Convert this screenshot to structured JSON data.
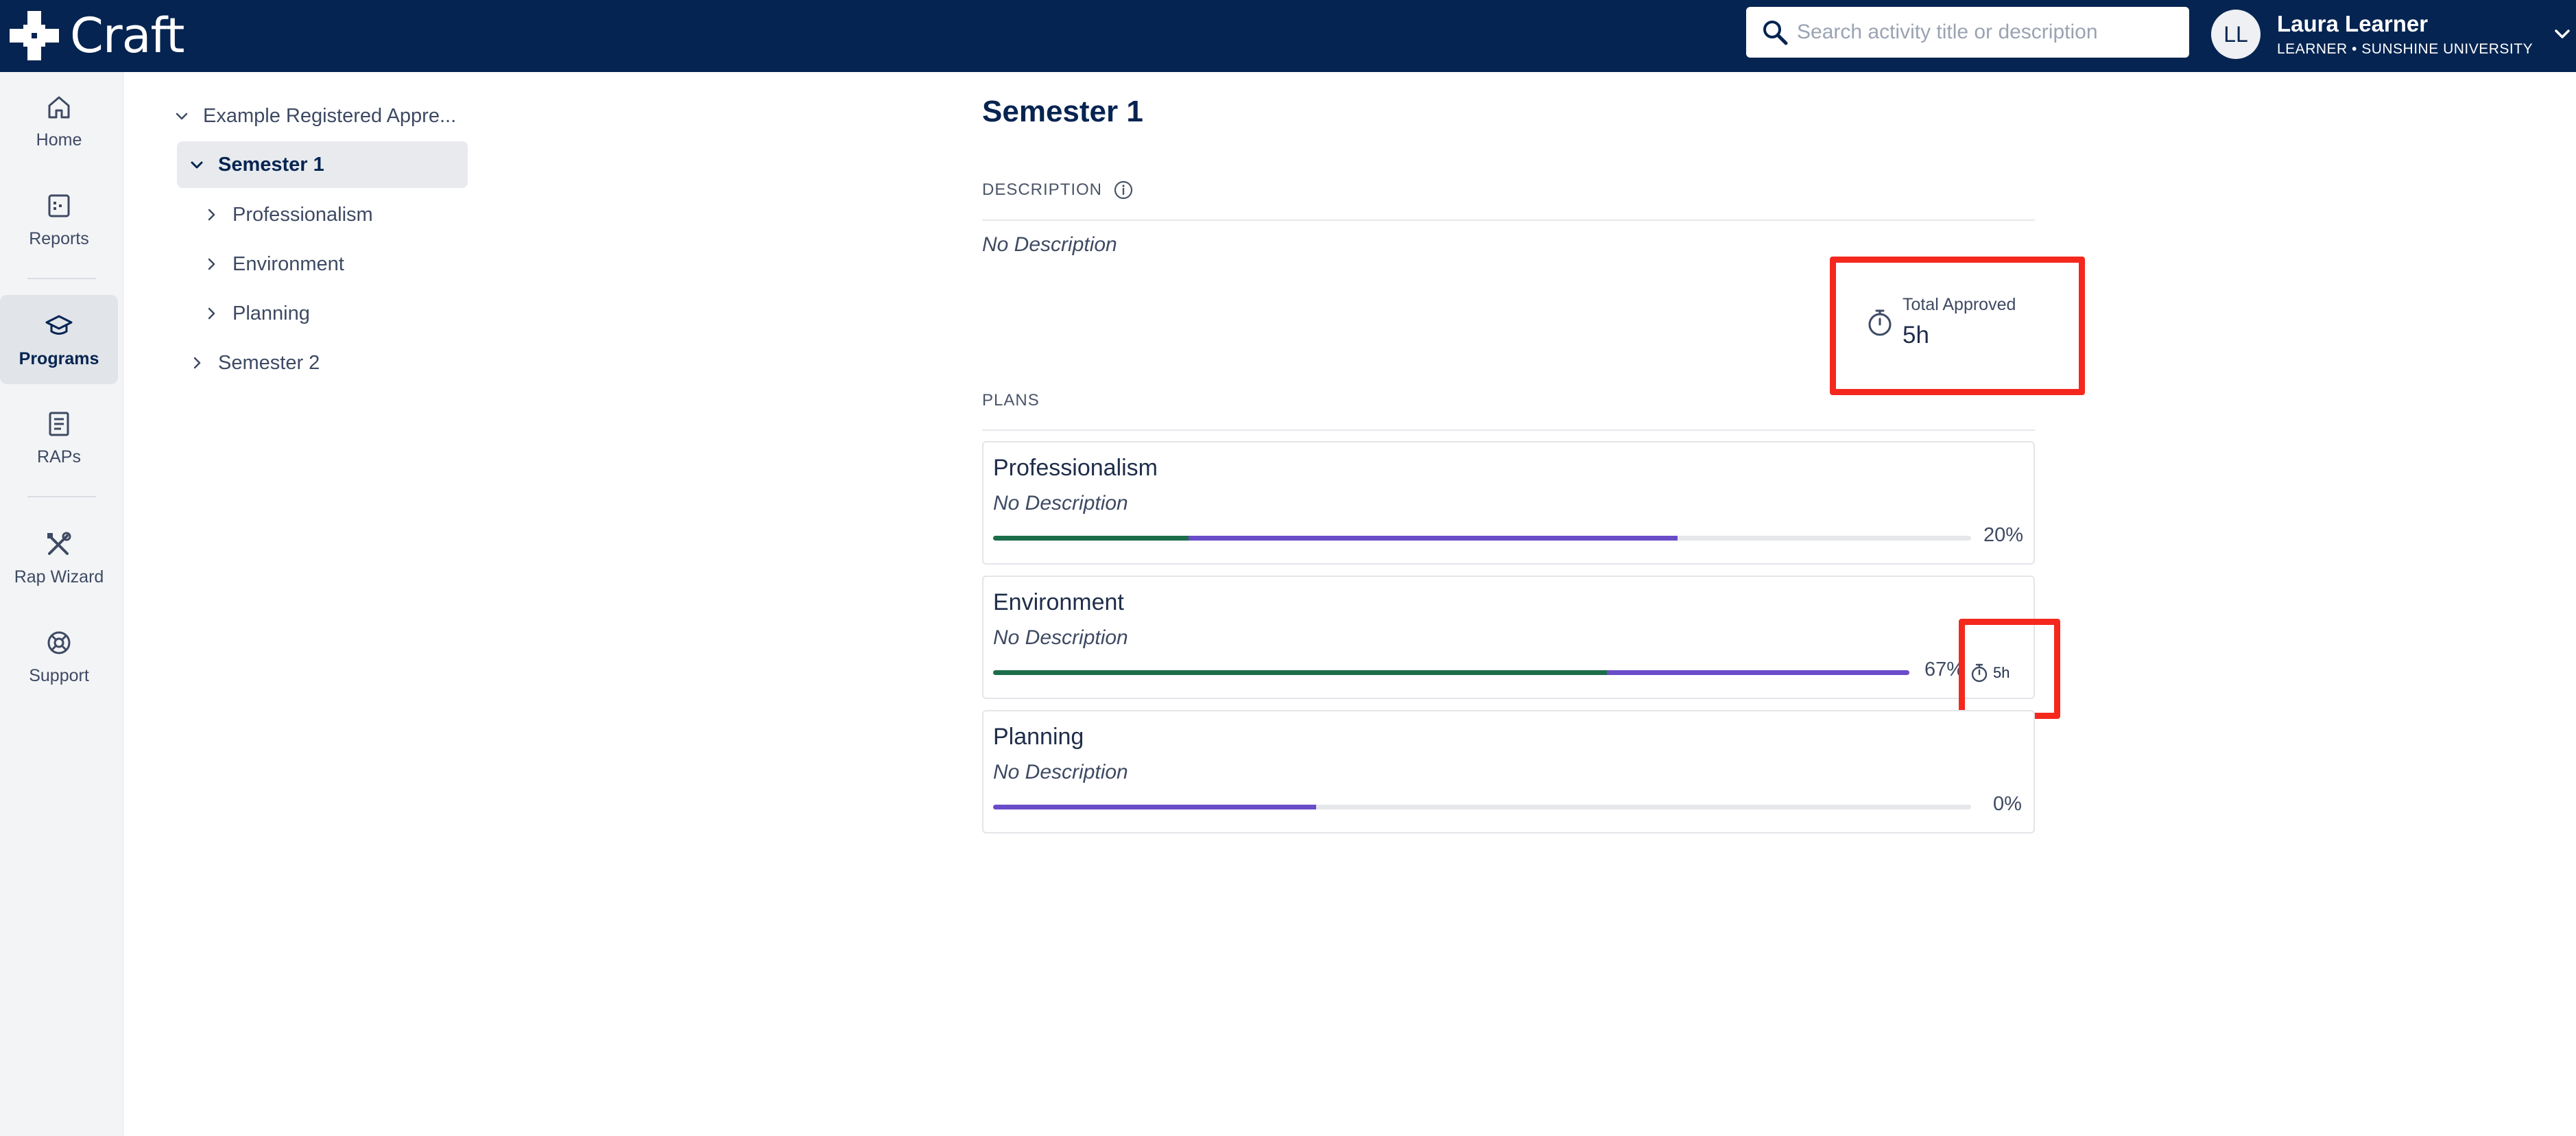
{
  "app": {
    "name": "Craft"
  },
  "search": {
    "placeholder": "Search activity title or description"
  },
  "user": {
    "initials": "LL",
    "name": "Laura Learner",
    "role": "LEARNER • SUNSHINE UNIVERSITY"
  },
  "nav": {
    "items": [
      {
        "label": "Home",
        "icon": "home-icon"
      },
      {
        "label": "Reports",
        "icon": "reports-icon"
      },
      {
        "label": "Programs",
        "icon": "graduation-cap-icon",
        "active": true
      },
      {
        "label": "RAPs",
        "icon": "document-icon"
      },
      {
        "label": "Rap Wizard",
        "icon": "tools-icon"
      },
      {
        "label": "Support",
        "icon": "lifebuoy-icon"
      }
    ]
  },
  "tree": {
    "root": "Example Registered Appre...",
    "semester1": "Semester 1",
    "children": [
      "Professionalism",
      "Environment",
      "Planning"
    ],
    "semester2": "Semester 2"
  },
  "main": {
    "title": "Semester 1",
    "description_label": "DESCRIPTION",
    "description_text": "No Description",
    "total_label": "Total Approved",
    "total_value": "5h",
    "plans_label": "PLANS",
    "plans": [
      {
        "title": "Professionalism",
        "description": "No Description",
        "green": 0.2,
        "purple_end": 0.7,
        "percent": "20%"
      },
      {
        "title": "Environment",
        "description": "No Description",
        "green": 0.67,
        "purple_end": 1.0,
        "percent": "67%",
        "hours": "5h"
      },
      {
        "title": "Planning",
        "description": "No Description",
        "green": 0.0,
        "purple_end": 0.33,
        "percent": "0%"
      }
    ]
  },
  "colors": {
    "topbar": "#052451",
    "progress_green": "#1c6d4a",
    "progress_purple": "#6a4cc8",
    "highlight": "#f5281e"
  }
}
